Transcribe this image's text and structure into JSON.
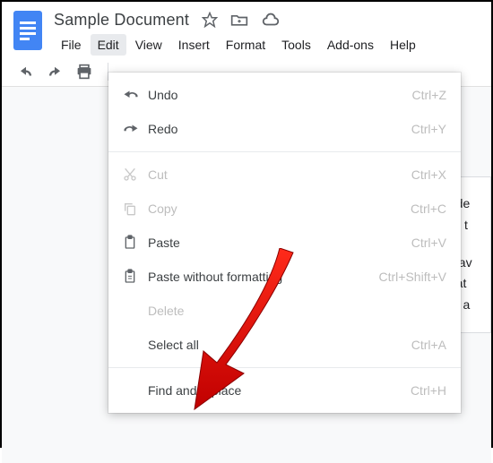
{
  "header": {
    "title": "Sample Document"
  },
  "menubar": {
    "items": [
      {
        "label": "File"
      },
      {
        "label": "Edit"
      },
      {
        "label": "View"
      },
      {
        "label": "Insert"
      },
      {
        "label": "Format"
      },
      {
        "label": "Tools"
      },
      {
        "label": "Add-ons"
      },
      {
        "label": "Help"
      }
    ],
    "open_index": 1
  },
  "edit_menu": {
    "undo": {
      "label": "Undo",
      "shortcut": "Ctrl+Z"
    },
    "redo": {
      "label": "Redo",
      "shortcut": "Ctrl+Y"
    },
    "cut": {
      "label": "Cut",
      "shortcut": "Ctrl+X"
    },
    "copy": {
      "label": "Copy",
      "shortcut": "Ctrl+C"
    },
    "paste": {
      "label": "Paste",
      "shortcut": "Ctrl+V"
    },
    "paste_plain": {
      "label": "Paste without formatting",
      "shortcut": "Ctrl+Shift+V"
    },
    "delete": {
      "label": "Delete"
    },
    "select_all": {
      "label": "Select all",
      "shortcut": "Ctrl+A"
    },
    "find_replace": {
      "label": "Find and replace",
      "shortcut": "Ctrl+H"
    }
  },
  "page_fragment": {
    "line1": "o de",
    "line2": "ws t",
    "line3": "y fav",
    "line4": "that",
    "line5": "er, a"
  }
}
